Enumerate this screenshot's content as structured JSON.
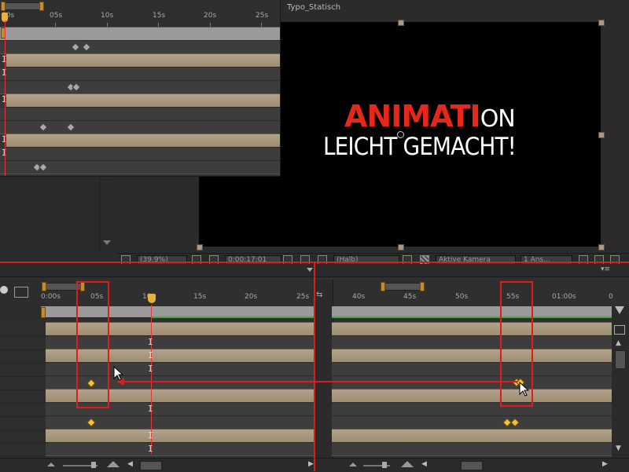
{
  "comp": {
    "title": "Typo_Statisch",
    "text_red": "ANIMATI",
    "text_white_end": "ON",
    "line2": "LEICHT GEMACHT!"
  },
  "popup_ruler": {
    "ticks": [
      "00s",
      "05s",
      "10s",
      "15s",
      "20s",
      "25s"
    ]
  },
  "viewer_bar": {
    "zoom": "(39,9%)",
    "timecode": "0;00;17;01",
    "resolution": "(Halb)",
    "camera": "Aktive Kamera",
    "views": "1 Ans..."
  },
  "left_timeline": {
    "ticks": [
      "0:00s",
      "05s",
      "10s",
      "15s",
      "20s",
      "25s"
    ]
  },
  "right_timeline": {
    "ticks": [
      "40s",
      "45s",
      "50s",
      "55s",
      "01:00s",
      "0"
    ]
  },
  "colors": {
    "highlight": "#e01b1b",
    "keyframe": "#f2c23a",
    "text_red": "#e8271b"
  },
  "icons": {
    "eye": "eye-icon",
    "graph": "graph-editor-icon",
    "cursor": "mouse-pointer-icon"
  }
}
